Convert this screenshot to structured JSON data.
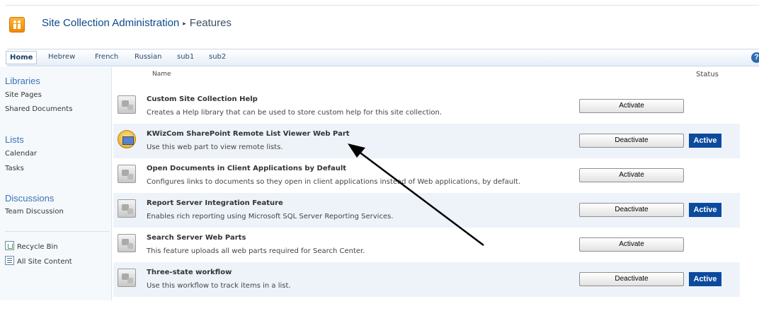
{
  "header": {
    "site_title": "Site Collection Administration",
    "separator": "▸",
    "page_title": "Features"
  },
  "topnav": {
    "tabs": [
      {
        "label": "Home",
        "selected": true
      },
      {
        "label": "Hebrew"
      },
      {
        "label": "French"
      },
      {
        "label": "Russian"
      },
      {
        "label": "sub1"
      },
      {
        "label": "sub2"
      }
    ],
    "help_label": "?"
  },
  "leftnav": {
    "libraries": {
      "heading": "Libraries",
      "items": [
        "Site Pages",
        "Shared Documents"
      ]
    },
    "lists": {
      "heading": "Lists",
      "items": [
        "Calendar",
        "Tasks"
      ]
    },
    "discussions": {
      "heading": "Discussions",
      "items": [
        "Team Discussion"
      ]
    },
    "recycle_bin": "Recycle Bin",
    "all_site_content": "All Site Content"
  },
  "table": {
    "col_name": "Name",
    "col_status": "Status"
  },
  "features": [
    {
      "title": "Custom Site Collection Help",
      "description": "Creates a Help library that can be used to store custom help for this site collection.",
      "button": "Activate",
      "status": "",
      "icon": "puzzle-icon"
    },
    {
      "title": "KWizCom SharePoint Remote List Viewer Web Part",
      "description": "Use this web part to view remote lists.",
      "button": "Deactivate",
      "status": "Active",
      "icon": "kwizcom-icon"
    },
    {
      "title": "Open Documents in Client Applications by Default",
      "description": "Configures links to documents so they open in client applications instead of Web applications, by default.",
      "button": "Activate",
      "status": "",
      "icon": "puzzle-icon"
    },
    {
      "title": "Report Server Integration Feature",
      "description": "Enables rich reporting using Microsoft SQL Server Reporting Services.",
      "button": "Deactivate",
      "status": "Active",
      "icon": "puzzle-icon"
    },
    {
      "title": "Search Server Web Parts",
      "description": "This feature uploads all web parts required for Search Center.",
      "button": "Activate",
      "status": "",
      "icon": "puzzle-icon"
    },
    {
      "title": "Three-state workflow",
      "description": "Use this workflow to track items in a list.",
      "button": "Deactivate",
      "status": "Active",
      "icon": "puzzle-icon"
    }
  ],
  "colors": {
    "accent": "#0c4a9e",
    "nav_heading": "#3a73b8",
    "alt_row": "#eef3fa"
  }
}
